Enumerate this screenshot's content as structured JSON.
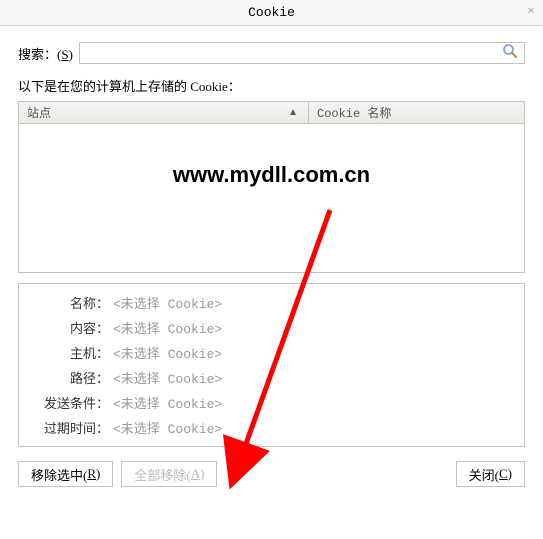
{
  "titlebar": {
    "title": "Cookie",
    "close": "×"
  },
  "search": {
    "label_prefix": "搜索：(",
    "label_key": "S",
    "label_suffix": ")"
  },
  "stored_label": "以下是在您的计算机上存储的 Cookie：",
  "table": {
    "col_site": "站点",
    "col_name": "Cookie 名称",
    "sort_indicator": "▲"
  },
  "watermark": "www.mydll.com.cn",
  "details": {
    "rows": [
      {
        "label": "名称：",
        "value": "<未选择 Cookie>"
      },
      {
        "label": "内容：",
        "value": "<未选择 Cookie>"
      },
      {
        "label": "主机：",
        "value": "<未选择 Cookie>"
      },
      {
        "label": "路径：",
        "value": "<未选择 Cookie>"
      },
      {
        "label": "发送条件：",
        "value": "<未选择 Cookie>"
      },
      {
        "label": "过期时间：",
        "value": "<未选择 Cookie>"
      }
    ]
  },
  "buttons": {
    "remove_selected_prefix": "移除选中(",
    "remove_selected_key": "R",
    "remove_selected_suffix": ")",
    "remove_all_prefix": "全部移除(",
    "remove_all_key": "A",
    "remove_all_suffix": ")",
    "close_prefix": "关闭(",
    "close_key": "C",
    "close_suffix": ")"
  }
}
